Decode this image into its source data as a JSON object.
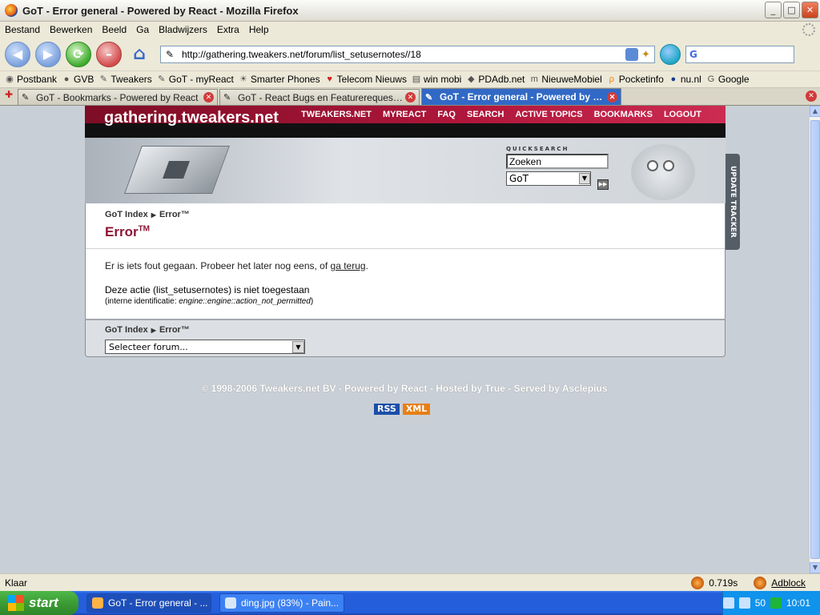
{
  "window": {
    "title": "GoT - Error general - Powered by React - Mozilla Firefox",
    "min": "_",
    "max": "□",
    "close": "✕"
  },
  "menu": [
    "Bestand",
    "Bewerken",
    "Beeld",
    "Ga",
    "Bladwijzers",
    "Extra",
    "Help"
  ],
  "nav": {
    "url": "http://gathering.tweakers.net/forum/list_setusernotes//18",
    "search_placeholder": "G"
  },
  "bookmarks": [
    {
      "label": "Postbank",
      "icon": "postbank-icon"
    },
    {
      "label": "GVB",
      "icon": "gvb-icon"
    },
    {
      "label": "Tweakers",
      "icon": "tweakers-icon"
    },
    {
      "label": "GoT - myReact",
      "icon": "react-icon"
    },
    {
      "label": "Smarter Phones",
      "icon": "phone-icon"
    },
    {
      "label": "Telecom Nieuws",
      "icon": "telecom-icon"
    },
    {
      "label": "win mobi",
      "icon": "winmobi-icon"
    },
    {
      "label": "PDAdb.net",
      "icon": "pdadb-icon"
    },
    {
      "label": "NieuweMobiel",
      "icon": "nieuwemobiel-icon"
    },
    {
      "label": "Pocketinfo",
      "icon": "pocketinfo-icon"
    },
    {
      "label": "nu.nl",
      "icon": "nunl-icon"
    },
    {
      "label": "Google",
      "icon": "google-icon"
    }
  ],
  "tabs": [
    {
      "label": "GoT - Bookmarks - Powered by React"
    },
    {
      "label": "GoT - React Bugs en Featurerequests - N..."
    },
    {
      "label": "GoT - Error general - Powered by Re..."
    }
  ],
  "site": {
    "logo_plain": "gathering.",
    "logo_bold": "tweakers",
    "logo_tail": ".net",
    "nav": [
      "TWEAKERS.NET",
      "MYREACT",
      "FAQ",
      "SEARCH",
      "ACTIVE TOPICS",
      "BOOKMARKS",
      "LOGOUT"
    ],
    "quicksearch_label": "QUICKSEARCH",
    "quicksearch_value": "Zoeken",
    "quicksearch_select": "GoT",
    "update_tracker": "UPDATE TRACKER",
    "crumb_root": "GoT Index",
    "crumb_current": "Error™",
    "error_title": "Error",
    "error_tm": "TM",
    "msg_before": "Er is iets fout gegaan. Probeer het later nog eens, of ",
    "msg_link": "ga terug",
    "msg_after": ".",
    "msg2": "Deze actie (list_setusernotes) is niet toegestaan",
    "msg3_prefix": "(interne identificatie: ",
    "msg3_code": "engine::engine::action_not_permitted",
    "msg3_suffix": ")",
    "forum_select": "Selecteer forum...",
    "copyright": "© 1998-2006 Tweakers.net BV - Powered by React - Hosted by True - Served by Asclepius",
    "rss": "RSS",
    "xml": "XML"
  },
  "status": {
    "text": "Klaar",
    "time": "0.719s",
    "adblock": "Adblock"
  },
  "taskbar": {
    "start": "start",
    "tasks": [
      "GoT - Error general - ...",
      "ding.jpg (83%) - Pain..."
    ],
    "tray_num": "50",
    "clock": "10:01"
  }
}
